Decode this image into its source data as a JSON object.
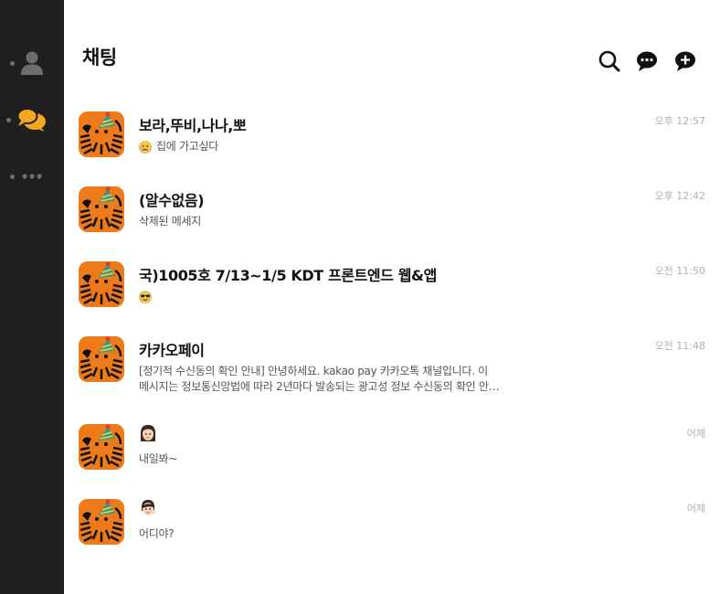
{
  "sidebar": {
    "items": [
      {
        "name": "friends",
        "icon": "person-icon",
        "active": false
      },
      {
        "name": "chats",
        "icon": "chat-bubbles-icon",
        "active": true
      },
      {
        "name": "more",
        "icon": "more-dots-icon",
        "active": false
      }
    ],
    "accent_color": "#f5a623"
  },
  "header": {
    "title": "채팅",
    "icons": [
      "search-icon",
      "open-chat-icon",
      "new-chat-icon"
    ]
  },
  "chats": [
    {
      "name": "보라,뚜비,나나,뽀",
      "message": "집에 가고싶다",
      "message_emoji": "sad-face-emoji",
      "time": "오후 12:57"
    },
    {
      "name": "(알수없음)",
      "message": "삭제된 메세지",
      "time": "오후 12:42"
    },
    {
      "name": "국)1005호 7/13~1/5 KDT 프론트엔드 웹&앱",
      "message": "",
      "message_emoji": "sunglasses-emoji",
      "time": "오전 11:50"
    },
    {
      "name": "카카오페이",
      "message": "[정기적 수신동의 확인 안내] 안녕하세요. kakao pay 카카오톡 채널입니다. 이 메시지는 정보통신망법에 따라 2년마다 발송되는 광고성 정보 수신동의 확인 안내입니다.",
      "time": "오전 11:48"
    },
    {
      "name": "",
      "name_emoji": "woman-face-emoji",
      "message": "내일봐~",
      "time": "어제"
    },
    {
      "name": "",
      "name_emoji": "girl-face-emoji",
      "message": "어디야?",
      "time": "어제"
    }
  ],
  "colors": {
    "sidebar_bg": "#1f1f1f",
    "avatar_orange": "#ef7a1a",
    "time_gray": "#b0b0b0"
  }
}
